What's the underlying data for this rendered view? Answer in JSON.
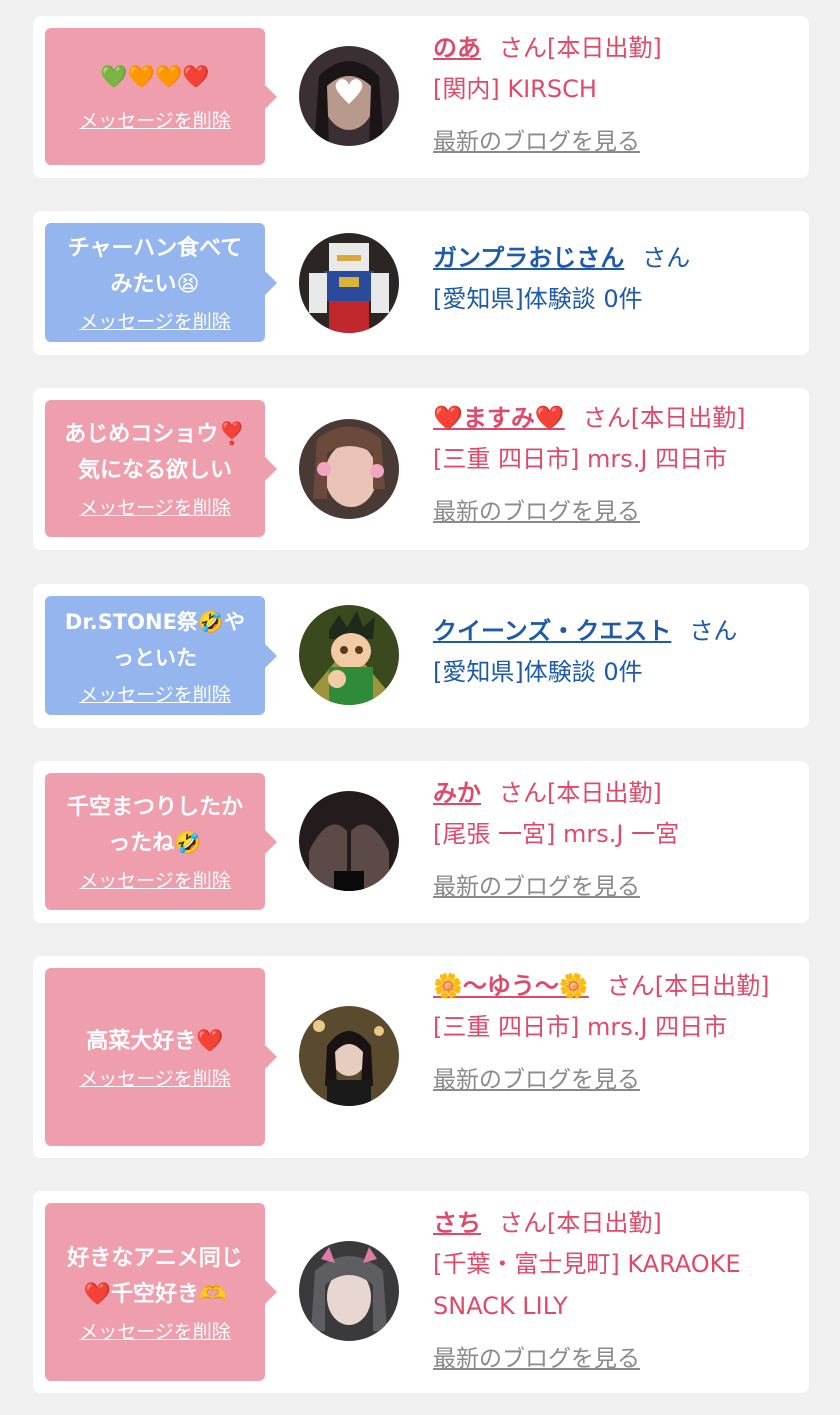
{
  "cards": [
    {
      "bubble_color": "pink",
      "message": "💚🧡🧡❤️",
      "delete_label": "メッセージを削除",
      "name": "のあ",
      "suffix": "さん[本日出勤]",
      "location": "[関内] KIRSCH",
      "blog_label": "最新のブログを見る",
      "text_color": "pink"
    },
    {
      "bubble_color": "blue",
      "message": "チャーハン食べて\nみたい😫",
      "delete_label": "メッセージを削除",
      "name": "ガンプラおじさん",
      "suffix": "さん",
      "location": "[愛知県]体験談 0件",
      "text_color": "blue"
    },
    {
      "bubble_color": "pink",
      "message": "あじめコショウ❣️\n気になる欲しい",
      "delete_label": "メッセージを削除",
      "name": "❤️ますみ❤️",
      "suffix": "さん[本日出勤]",
      "location": "[三重 四日市] mrs.J 四日市",
      "blog_label": "最新のブログを見る",
      "text_color": "pink"
    },
    {
      "bubble_color": "blue",
      "message": "Dr.STONE祭🤣や\nっといた",
      "delete_label": "メッセージを削除",
      "name": "クイーンズ・クエスト",
      "suffix": "さん",
      "location": "[愛知県]体験談 0件",
      "text_color": "blue"
    },
    {
      "bubble_color": "pink",
      "message": "千空まつりしたか\nったね🤣",
      "delete_label": "メッセージを削除",
      "name": "みか",
      "suffix": "さん[本日出勤]",
      "location": "[尾張 一宮] mrs.J 一宮",
      "blog_label": "最新のブログを見る",
      "text_color": "pink"
    },
    {
      "bubble_color": "pink",
      "message": "高菜大好き❤️",
      "delete_label": "メッセージを削除",
      "name": "🌼〜ゆう〜🌼",
      "suffix": "さん[本日出勤]",
      "location": "[三重 四日市] mrs.J 四日市",
      "blog_label": "最新のブログを見る",
      "text_color": "pink"
    },
    {
      "bubble_color": "pink",
      "message": "好きなアニメ同じ\n❤️千空好き🫶",
      "delete_label": "メッセージを削除",
      "name": "さち",
      "suffix": "さん[本日出勤]",
      "location": "[千葉・富士見町] KARAOKE SNACK LILY",
      "blog_label": "最新のブログを見る",
      "text_color": "pink"
    }
  ],
  "colors": {
    "pink_bubble": "#ef9eae",
    "blue_bubble": "#94b5ee",
    "pink_text": "#e04a6a",
    "blue_text": "#1d5aa8",
    "page_bg": "#f0f0f0"
  }
}
